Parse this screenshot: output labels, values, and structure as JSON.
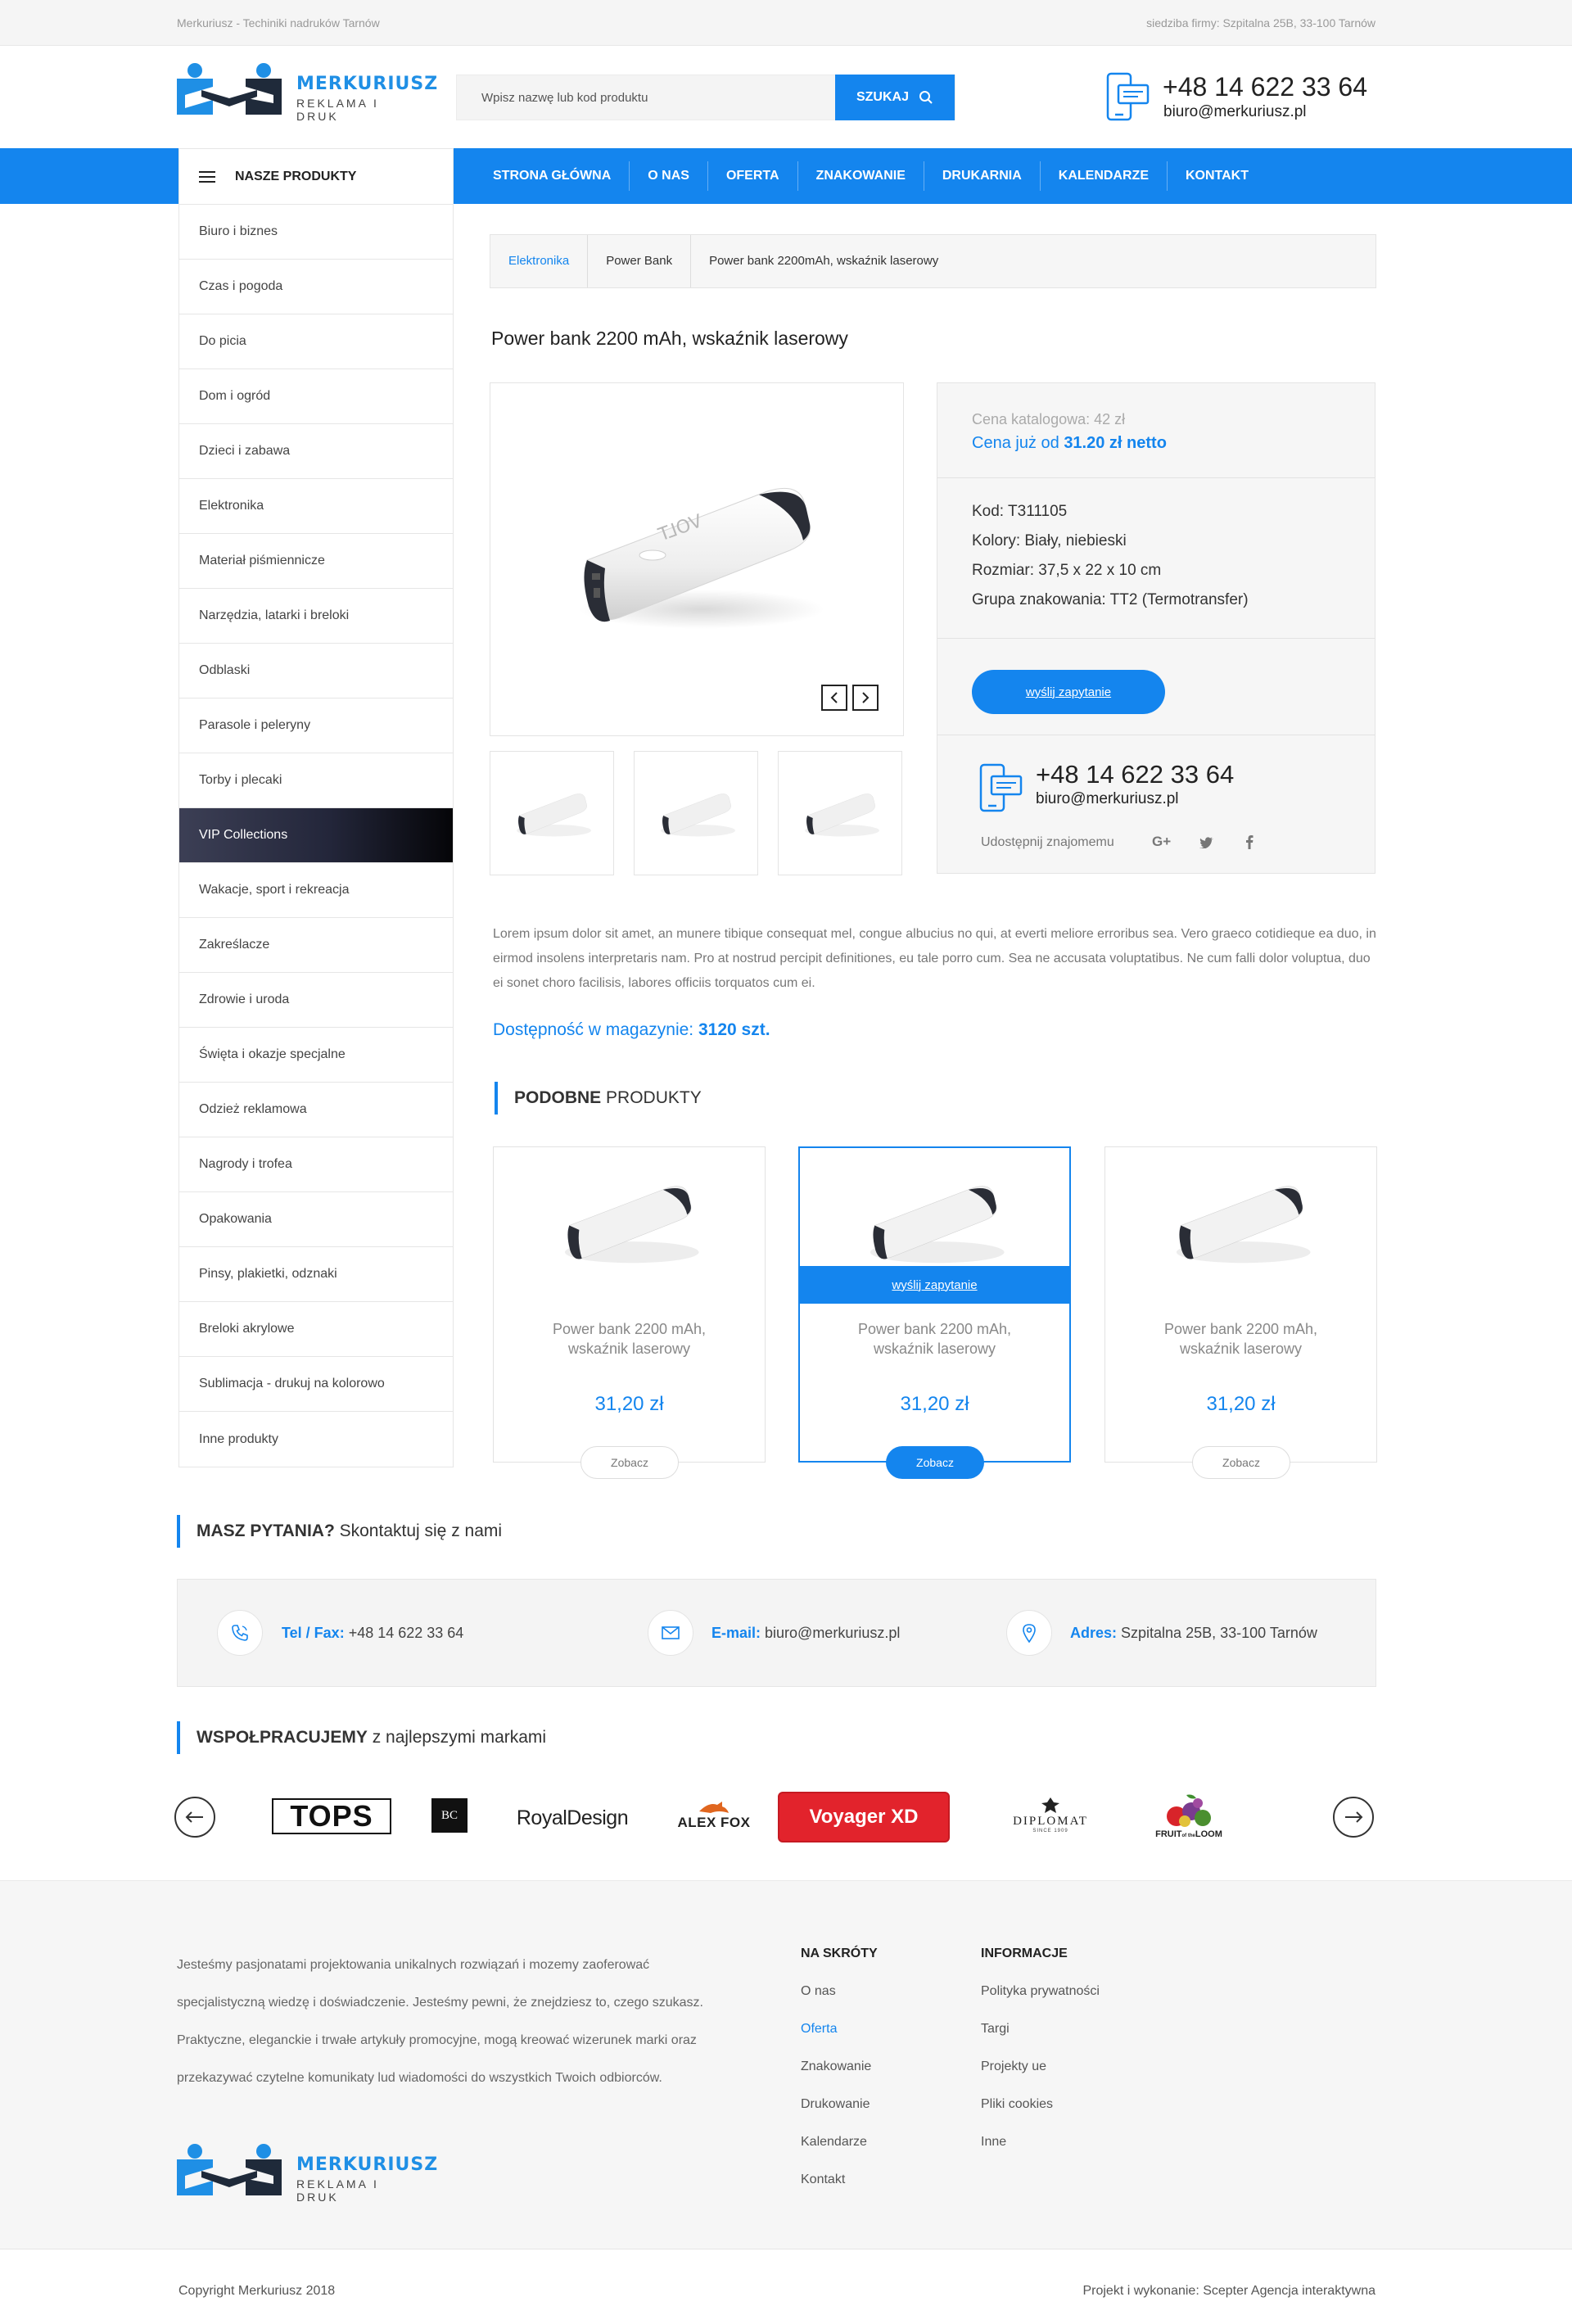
{
  "topbar": {
    "left": "Merkuriusz - Techiniki nadruków Tarnów",
    "right": "siedziba firmy: Szpitalna 25B, 33-100 Tarnów"
  },
  "header": {
    "logo_brand": "MERKURIUSZ",
    "logo_tag": "REKLAMA I DRUK",
    "search_placeholder": "Wpisz nazwę lub kod produktu",
    "search_button": "SZUKAJ",
    "phone": "+48 14 622 33 64",
    "email": "biuro@merkuriusz.pl"
  },
  "nav": {
    "products_label": "NASZE PRODUKTY",
    "items": [
      "STRONA GŁÓWNA",
      "O NAS",
      "OFERTA",
      "ZNAKOWANIE",
      "DRUKARNIA",
      "KALENDARZE",
      "KONTAKT"
    ]
  },
  "sidebar": {
    "active": "VIP Collections",
    "categories": [
      "Biuro i biznes",
      "Czas i pogoda",
      "Do picia",
      "Dom i ogród",
      "Dzieci i zabawa",
      "Elektronika",
      "Materiał piśmiennicze",
      "Narzędzia, latarki i breloki",
      "Odblaski",
      "Parasole i peleryny",
      "Torby i plecaki",
      "VIP Collections",
      "Wakacje, sport i rekreacja",
      "Zakreślacze",
      "Zdrowie i uroda",
      "Święta i okazje specjalne",
      "Odzież reklamowa",
      "Nagrody i trofea",
      "Opakowania",
      "Pinsy, plakietki, odznaki",
      "Breloki akrylowe",
      "Sublimacja - drukuj na kolorowo",
      "Inne produkty"
    ]
  },
  "breadcrumb": [
    "Elektronika",
    "Power Bank",
    "Power bank 2200mAh, wskaźnik laserowy"
  ],
  "product": {
    "title": "Power bank 2200 mAh, wskaźnik laserowy",
    "catalog_price": "Cena katalogowa: 42 zł",
    "price_prefix": "Cena już od",
    "price_value": "31.20 zł netto",
    "specs": [
      "Kod: T311105",
      "Kolory: Biały, niebieski",
      "Rozmiar: 37,5 x 22 x 10 cm",
      "Grupa znakowania: TT2 (Termotransfer)"
    ],
    "inquiry_button": "wyślij zapytanie",
    "phone": "+48 14 622 33 64",
    "email": "biuro@merkuriusz.pl",
    "share_label": "Udostępnij znajomemu",
    "product_text": "VOLT",
    "description": "Lorem ipsum dolor sit amet, an munere tibique consequat mel, congue albucius no qui, at everti meliore erroribus sea. Vero graeco cotidieque ea duo, in eirmod insolens interpretaris nam. Pro at nostrud percipit definitiones, eu tale porro cum. Sea ne accusata voluptatibus. Ne cum falli dolor voluptua, duo ei sonet choro facilisis, labores officiis torquatos cum ei.",
    "availability_prefix": "Dostępność w magazynie:",
    "availability_value": "3120 szt."
  },
  "similar": {
    "heading_bold": "PODOBNE",
    "heading_rest": " PRODUKTY",
    "cards": [
      {
        "name": "Power bank 2200 mAh, wskaźnik laserowy",
        "price": "31,20 zł",
        "button": "Zobacz"
      },
      {
        "name": "Power bank 2200 mAh, wskaźnik laserowy",
        "price": "31,20 zł",
        "button": "Zobacz",
        "overlay": "wyślij zapytanie"
      },
      {
        "name": "Power bank 2200 mAh, wskaźnik laserowy",
        "price": "31,20 zł",
        "button": "Zobacz"
      }
    ]
  },
  "questions": {
    "bold": "MASZ PYTANIA?",
    "rest": " Skontaktuj się z nami"
  },
  "contact_band": {
    "tel_label": "Tel / Fax:",
    "tel_value": " +48 14 622 33 64",
    "mail_label": "E-mail:",
    "mail_value": " biuro@merkuriusz.pl",
    "addr_label": "Adres:",
    "addr_value": " Szpitalna 25B, 33-100 Tarnów"
  },
  "partners": {
    "bold": "WSPOŁPRACUJEMY",
    "rest": " z najlepszymi markami",
    "brands": [
      "TOPS",
      "BC",
      "RoyalDesign",
      "ALEX FOX",
      "Voyager XD",
      "DIPLOMAT",
      "FRUIT of the LOOM"
    ],
    "brand_small": {
      "diplomat_sub": "SINCE 1909",
      "fruit_top": "FRUIT",
      "fruit_bottom": "LOOM",
      "fruit_mid": "of the"
    }
  },
  "footer": {
    "about": "Jesteśmy pasjonatami projektowania unikalnych rozwiązań i mozemy zaoferować specjalistyczną wiedzę i doświadczenie. Jesteśmy pewni, że znejdziesz to, czego szukasz. Praktyczne, eleganckie i trwałe artykuły promocyjne, mogą kreować wizerunek marki oraz przekazywać czytelne komunikaty lud wiadomości do wszystkich Twoich odbiorców.",
    "col1_title": "NA SKRÓTY",
    "col1": [
      "O nas",
      "Oferta",
      "Znakowanie",
      "Drukowanie",
      "Kalendarze",
      "Kontakt"
    ],
    "col1_active": "Oferta",
    "col2_title": "INFORMACJE",
    "col2": [
      "Polityka prywatności",
      "Targi",
      "Projekty ue",
      "Pliki cookies",
      "Inne"
    ],
    "copyright": "Copyright Merkuriusz 2018",
    "credits": "Projekt i wykonanie: Scepter Agencja interaktywna"
  },
  "colors": {
    "accent": "#1485ee",
    "brand_red": "#e2232c"
  }
}
